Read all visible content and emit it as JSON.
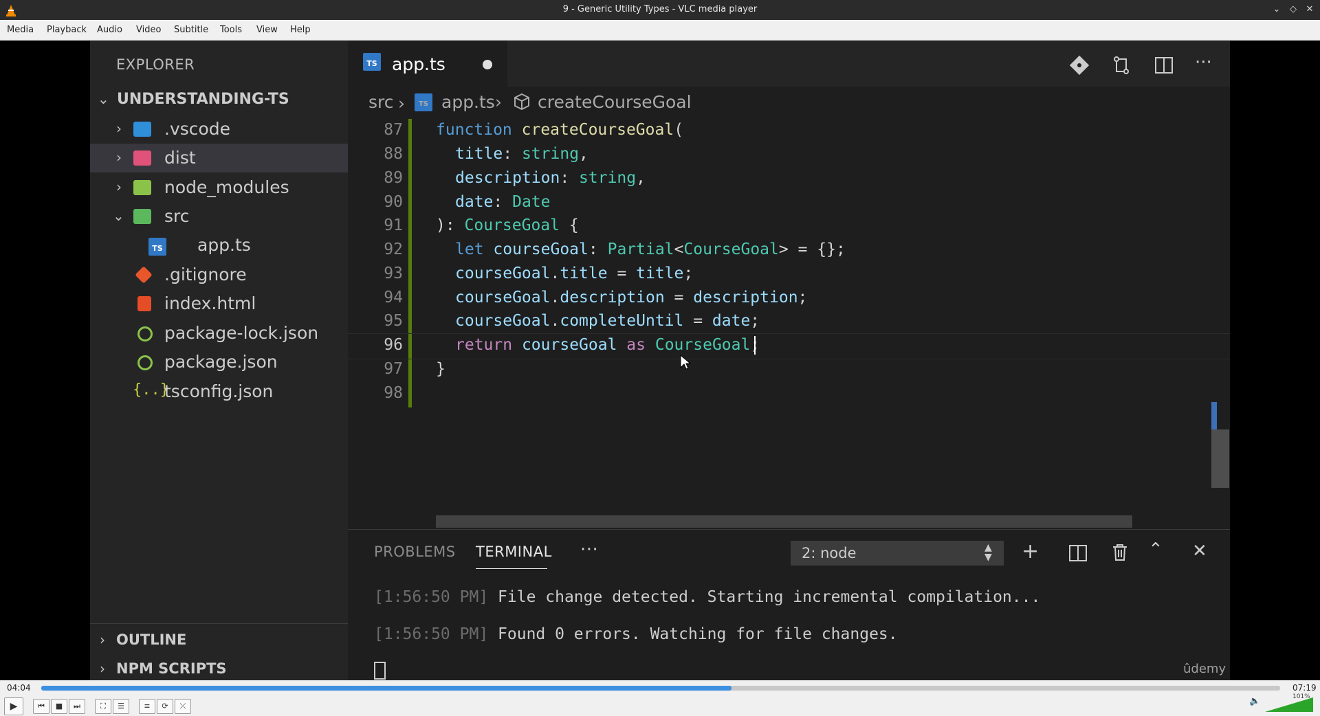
{
  "window": {
    "title": "9 - Generic Utility Types - VLC media player"
  },
  "menu": [
    "Media",
    "Playback",
    "Audio",
    "Video",
    "Subtitle",
    "Tools",
    "View",
    "Help"
  ],
  "explorer": {
    "title": "EXPLORER",
    "project": "UNDERSTANDING-TS",
    "items": [
      ".vscode",
      "dist",
      "node_modules",
      "src",
      "app.ts",
      ".gitignore",
      "index.html",
      "package-lock.json",
      "package.json",
      "tsconfig.json"
    ],
    "outline": "OUTLINE",
    "npm_scripts": "NPM SCRIPTS"
  },
  "editor": {
    "tab": "app.ts",
    "breadcrumb": [
      "src",
      "app.ts",
      "createCourseGoal"
    ],
    "line_numbers": [
      "87",
      "88",
      "89",
      "90",
      "91",
      "92",
      "93",
      "94",
      "95",
      "96",
      "97",
      "98"
    ]
  },
  "panel": {
    "tabs": [
      "PROBLEMS",
      "TERMINAL"
    ],
    "more": "···",
    "terminal_select": "2: node",
    "lines": [
      {
        "time": "[1:56:50 PM]",
        "text": "File change detected. Starting incremental compilation..."
      },
      {
        "time": "[1:56:50 PM]",
        "text": "Found 0 errors. Watching for file changes."
      }
    ],
    "watermark": "ûdemy"
  },
  "player": {
    "elapsed": "04:04",
    "total": "07:19",
    "progress": 0.557,
    "volume_percent": "101%"
  }
}
